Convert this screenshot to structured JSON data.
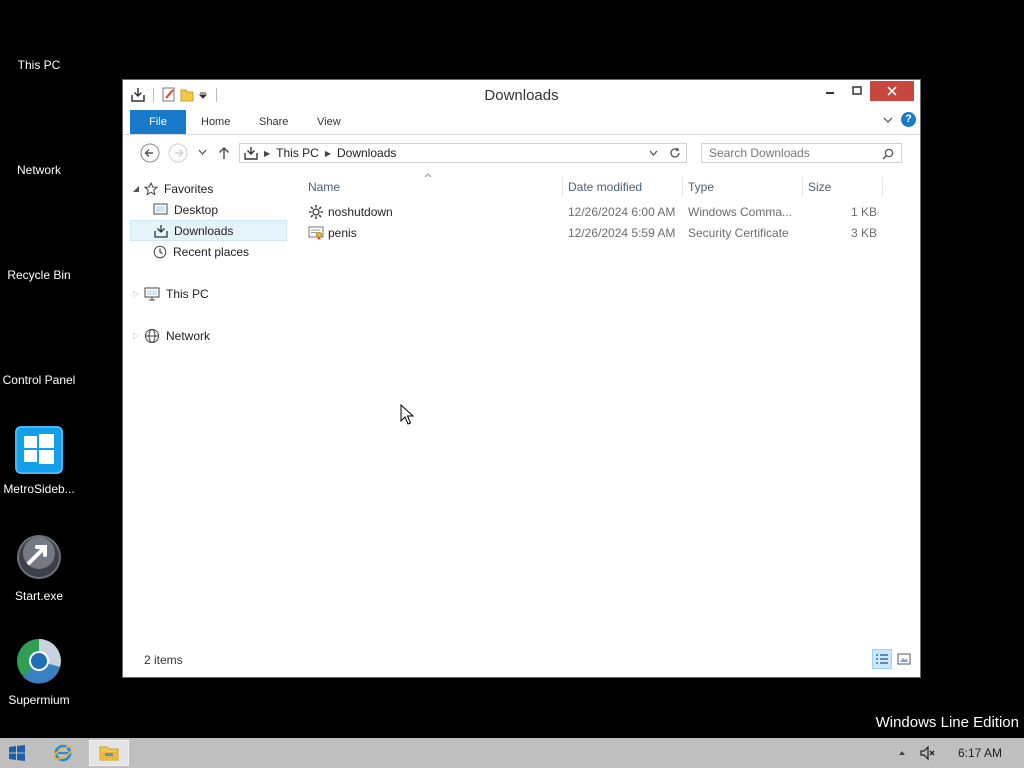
{
  "desktop": {
    "icons": [
      {
        "label": "This PC"
      },
      {
        "label": "Network"
      },
      {
        "label": "Recycle Bin"
      },
      {
        "label": "Control Panel"
      },
      {
        "label": "MetroSideb..."
      },
      {
        "label": "Start.exe"
      },
      {
        "label": "Supermium"
      }
    ],
    "watermark": "Windows Line Edition"
  },
  "window": {
    "title": "Downloads",
    "ribbon_tabs": [
      "File",
      "Home",
      "Share",
      "View"
    ],
    "breadcrumb": [
      "This PC",
      "Downloads"
    ],
    "search_placeholder": "Search Downloads",
    "nav": {
      "favorites": "Favorites",
      "favorites_items": [
        "Desktop",
        "Downloads",
        "Recent places"
      ],
      "this_pc": "This PC",
      "network": "Network"
    },
    "columns": [
      "Name",
      "Date modified",
      "Type",
      "Size"
    ],
    "files": [
      {
        "name": "noshutdown",
        "date": "12/26/2024 6:00 AM",
        "type": "Windows Comma...",
        "size": "1 KB",
        "icon": "gear-icon"
      },
      {
        "name": "penis",
        "date": "12/26/2024 5:59 AM",
        "type": "Security Certificate",
        "size": "3 KB",
        "icon": "certificate-icon"
      }
    ],
    "status": "2 items"
  },
  "taskbar": {
    "clock": "6:17 AM"
  },
  "colors": {
    "accent": "#1979ca",
    "close": "#c7463d",
    "taskbar": "#bfbfbf",
    "selection": "#e5f3fb"
  }
}
